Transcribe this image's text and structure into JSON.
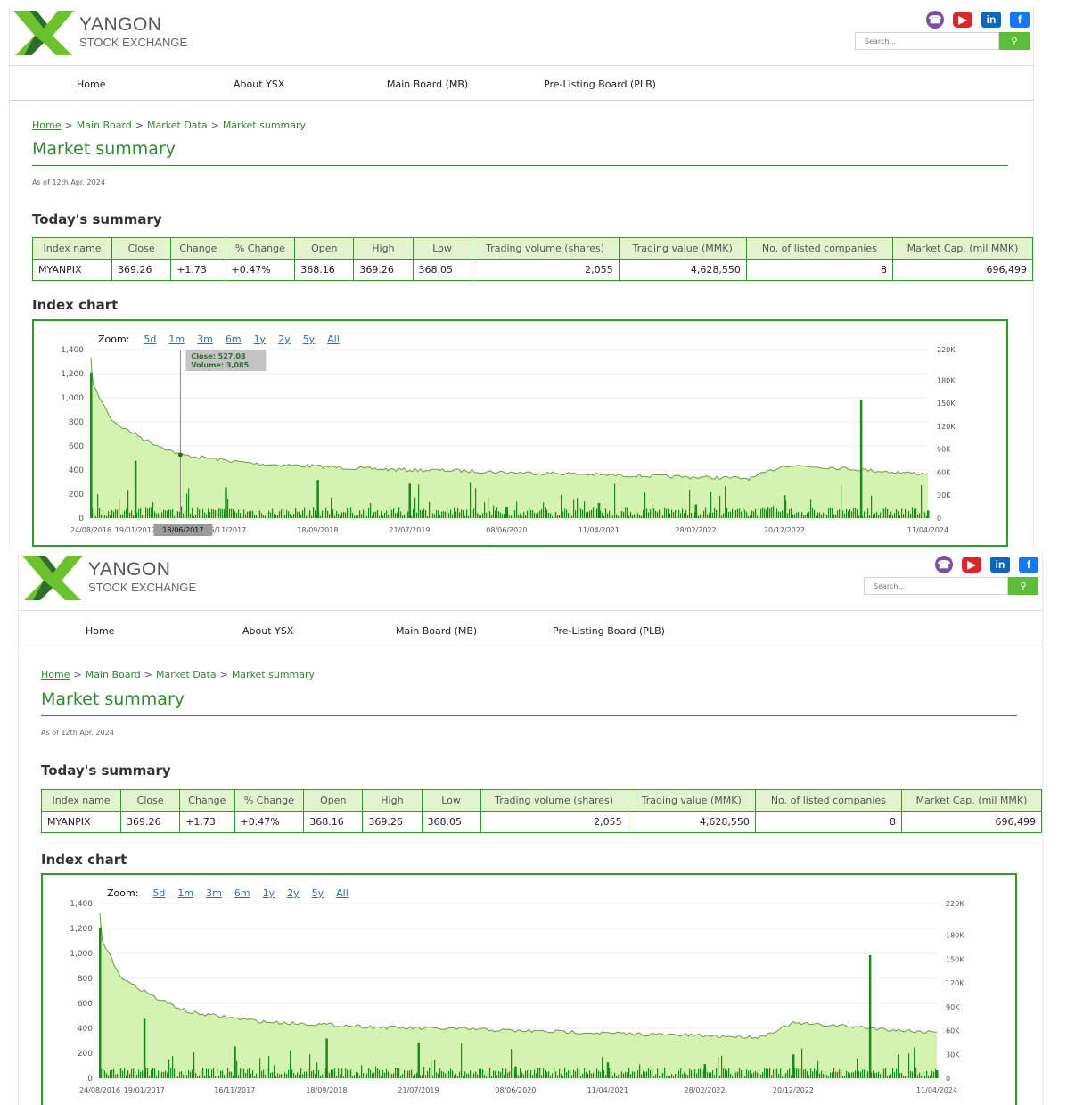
{
  "site": {
    "brand_line1": "YANGON",
    "brand_line2": "STOCK EXCHANGE",
    "search_placeholder": "Search...",
    "search_icon": "search-icon",
    "social": [
      "viber-icon",
      "youtube-icon",
      "linkedin-icon",
      "facebook-icon"
    ],
    "colors": {
      "accent": "#2f8a2f",
      "button": "#5cbd3a",
      "table_header": "#e2f3cf",
      "chart_area": "#d6f2b0",
      "chart_volume": "#1a8a1a"
    }
  },
  "nav": [
    {
      "label": "Home"
    },
    {
      "label": "About YSX"
    },
    {
      "label": "Main Board (MB)"
    },
    {
      "label": "Pre-Listing Board (PLB)"
    }
  ],
  "breadcrumb": {
    "home": "Home",
    "items": [
      "Main Board",
      "Market Data",
      "Market summary"
    ],
    "sep": ">"
  },
  "page": {
    "title": "Market summary",
    "as_of": "As of 12th Apr. 2024",
    "today_heading": "Today's summary",
    "chart_heading": "Index chart"
  },
  "summary_table": {
    "headers": [
      "Index name",
      "Close",
      "Change",
      "% Change",
      "Open",
      "High",
      "Low",
      "Trading volume (shares)",
      "Trading value (MMK)",
      "No. of listed companies",
      "Market Cap. (mil MMK)"
    ],
    "row": [
      "MYANPIX",
      "369.26",
      "+1.73",
      "+0.47%",
      "368.16",
      "369.26",
      "368.05",
      "2,055",
      "4,628,550",
      "8",
      "696,499"
    ]
  },
  "zoom": {
    "label": "Zoom:",
    "buttons": [
      "5d",
      "1m",
      "3m",
      "6m",
      "1y",
      "2y",
      "5y",
      "All"
    ]
  },
  "tooltip": {
    "close_label": "Close:",
    "close_value": "527.08",
    "volume_label": "Volume:",
    "volume_value": "3,085",
    "date": "18/06/2017"
  },
  "chart_data": {
    "type": "area",
    "title": "",
    "x_ticks": [
      "24/08/2016",
      "19/01/2017",
      "16/11/2017",
      "18/09/2018",
      "21/07/2019",
      "08/06/2020",
      "11/04/2021",
      "28/02/2022",
      "20/12/2022",
      "11/04/2024"
    ],
    "y_left_ticks": [
      "0",
      "200",
      "400",
      "600",
      "800",
      "1,000",
      "1,200",
      "1,400"
    ],
    "y_right_ticks": [
      "0",
      "30K",
      "60K",
      "90K",
      "120K",
      "150K",
      "180K",
      "220K"
    ],
    "ylim_left": [
      0,
      1400
    ],
    "ylim_right": [
      0,
      220000
    ],
    "series": [
      {
        "type": "area",
        "x": [
          "24/08/2016",
          "01/09/2016",
          "01/10/2016",
          "01/11/2016",
          "01/12/2016",
          "19/01/2017",
          "01/03/2017",
          "18/06/2017",
          "16/11/2017",
          "01/03/2018",
          "18/09/2018",
          "01/03/2019",
          "21/07/2019",
          "01/01/2020",
          "08/06/2020",
          "01/01/2021",
          "11/04/2021",
          "28/02/2022",
          "01/09/2022",
          "20/12/2022",
          "01/06/2023",
          "01/01/2024",
          "11/04/2024"
        ],
        "values": [
          1320,
          1100,
          960,
          820,
          760,
          700,
          640,
          527,
          480,
          450,
          430,
          410,
          400,
          395,
          380,
          370,
          360,
          340,
          330,
          440,
          420,
          380,
          369
        ]
      },
      {
        "type": "bar",
        "x": [
          "24/08/2016",
          "19/01/2017",
          "16/11/2017",
          "18/09/2018",
          "21/07/2019",
          "08/06/2020",
          "11/04/2021",
          "28/02/2022",
          "20/12/2022",
          "01/09/2023",
          "11/04/2024"
        ],
        "values": [
          190000,
          75000,
          40000,
          50000,
          45000,
          15000,
          20000,
          18000,
          30000,
          155000,
          10000
        ]
      }
    ],
    "grid": true,
    "legend": "none"
  }
}
